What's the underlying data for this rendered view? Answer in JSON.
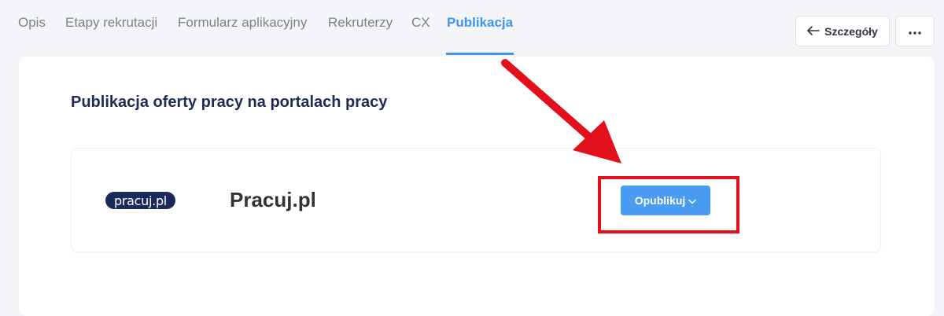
{
  "tabs": [
    {
      "label": "Opis",
      "active": false
    },
    {
      "label": "Etapy rekrutacji",
      "active": false
    },
    {
      "label": "Formularz aplikacyjny",
      "active": false
    },
    {
      "label": "Rekruterzy",
      "active": false
    },
    {
      "label": "CX",
      "active": false
    },
    {
      "label": "Publikacja",
      "active": true
    }
  ],
  "header": {
    "details_button": "Szczegóły",
    "details_icon": "arrow-left-icon",
    "more_icon": "more-dots-icon"
  },
  "section": {
    "title": "Publikacja oferty pracy na portalach pracy"
  },
  "portal": {
    "logo_text": "pracuj.pl",
    "name": "Pracuj.pl",
    "publish_button": "Opublikuj",
    "publish_icon": "chevron-down-icon"
  },
  "colors": {
    "accent": "#3d95f0",
    "button": "#4a9cf3",
    "title": "#1d2b55",
    "annotation": "#e3101c"
  }
}
